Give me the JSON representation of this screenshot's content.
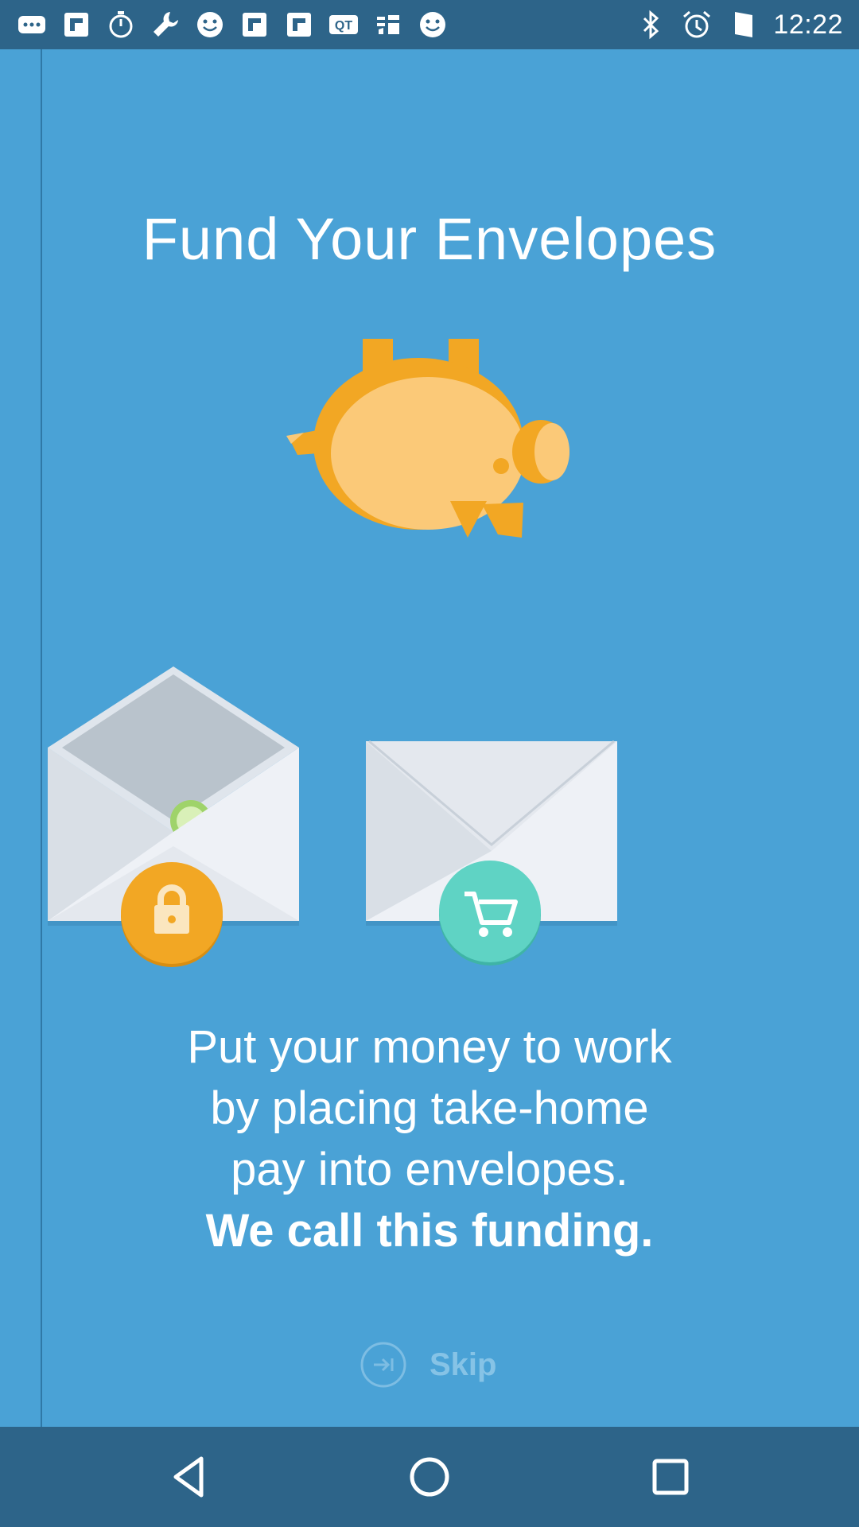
{
  "status_bar": {
    "time": "12:22",
    "left_icons": [
      "more-icon",
      "flipboard-icon",
      "stopwatch-icon",
      "wrench-icon",
      "smiley-icon",
      "flipboard-icon",
      "flipboard-icon",
      "qt-icon",
      "taobao-icon",
      "smiley-icon"
    ],
    "right_icons": [
      "bluetooth-icon",
      "alarm-icon",
      "signal-icon"
    ]
  },
  "onboarding": {
    "title": "Fund Your Envelopes",
    "description_lines": [
      "Put your money to work",
      "by placing take-home",
      "pay into envelopes."
    ],
    "emphasis": "We call this funding.",
    "skip_label": "Skip"
  },
  "colors": {
    "background": "#4aa2d6",
    "bars": "#2d6489",
    "accent_orange": "#f2a724",
    "accent_teal": "#5fd3c4"
  },
  "nav_bar": {
    "buttons": [
      "back-icon",
      "home-icon",
      "recents-icon"
    ]
  }
}
